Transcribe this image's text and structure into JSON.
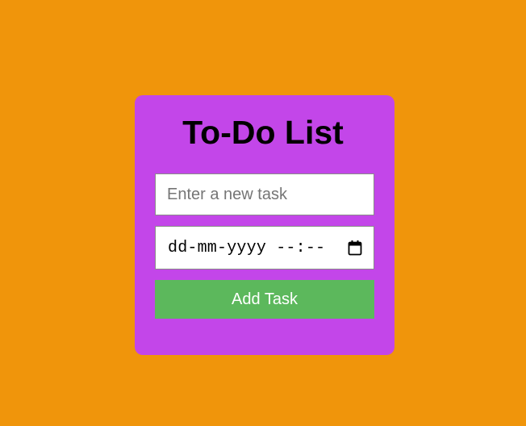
{
  "page": {
    "background_color": "#f0950b"
  },
  "card": {
    "title": "To-Do List",
    "background_color": "#c346e9"
  },
  "task_input": {
    "value": "",
    "placeholder": "Enter a new task"
  },
  "date_input": {
    "display_text": "dd-mm-yyyy --:--",
    "icon": "calendar-icon"
  },
  "add_button": {
    "label": "Add Task",
    "background_color": "#5cb85c"
  }
}
